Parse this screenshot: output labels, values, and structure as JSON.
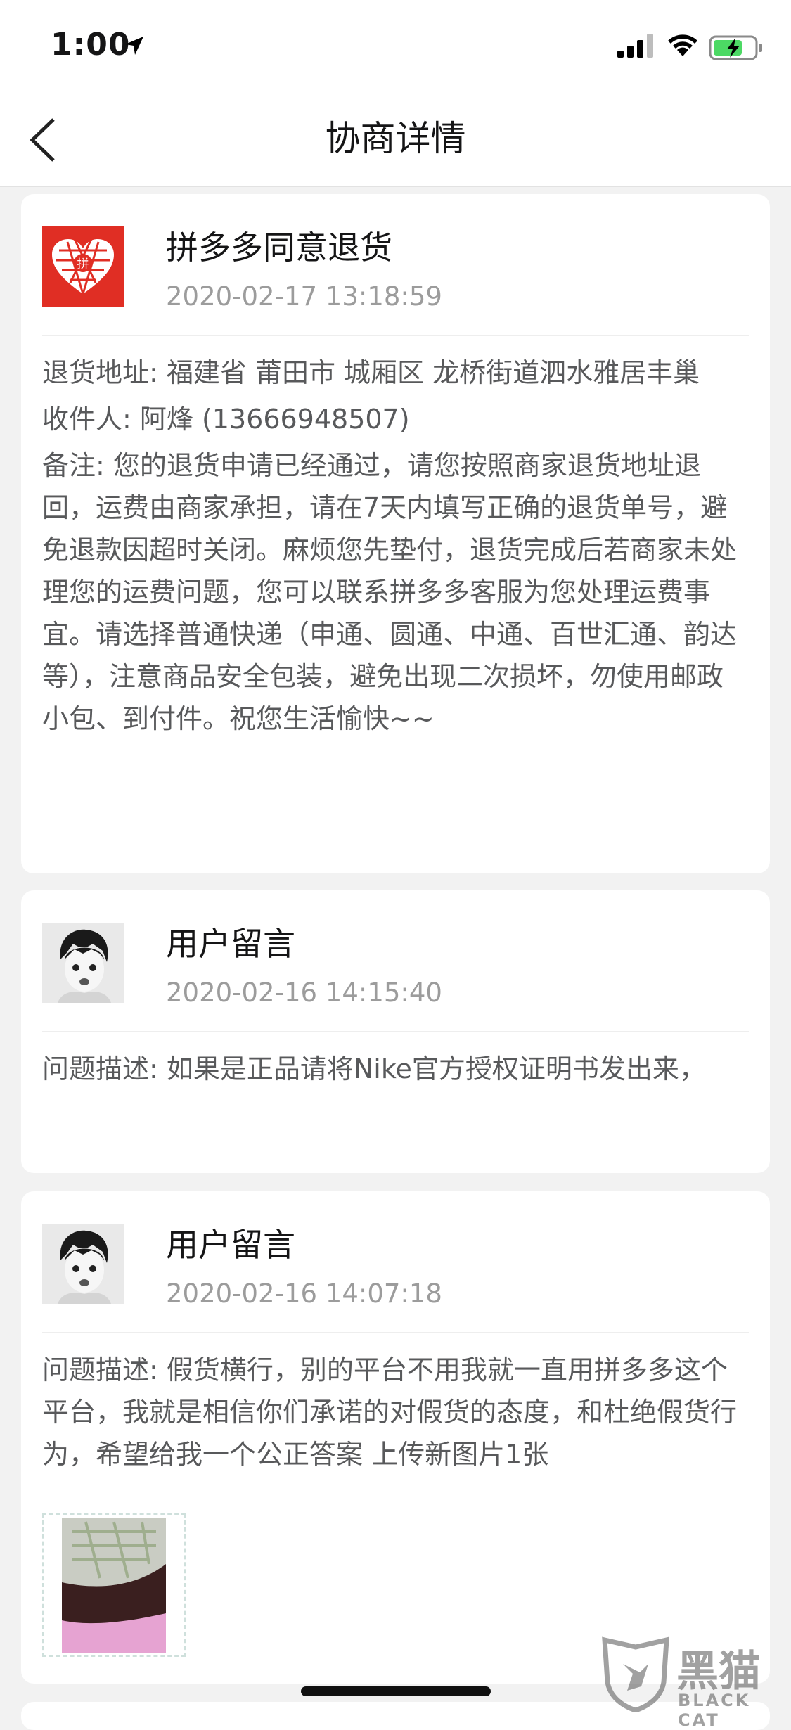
{
  "status_bar": {
    "time": "1:00"
  },
  "nav": {
    "title": "协商详情"
  },
  "cards": [
    {
      "title": "拼多多同意退货",
      "time": "2020-02-17 13:18:59",
      "lines": [
        "退货地址: 福建省 莆田市 城厢区 龙桥街道泗水雅居丰巢",
        "收件人: 阿烽 (13666948507)",
        "备注: 您的退货申请已经通过，请您按照商家退货地址退回，运费由商家承担，请在7天内填写正确的退货单号，避免退款因超时关闭。麻烦您先垫付，退货完成后若商家未处理您的运费问题，您可以联系拼多多客服为您处理运费事宜。请选择普通快递（申通、圆通、中通、百世汇通、韵达等），注意商品安全包装，避免出现二次损坏，勿使用邮政小包、到付件。祝您生活愉快~~"
      ]
    },
    {
      "title": "用户留言",
      "time": "2020-02-16 14:15:40",
      "lines": [
        "问题描述: 如果是正品请将Nike官方授权证明书发出来，"
      ]
    },
    {
      "title": "用户留言",
      "time": "2020-02-16 14:07:18",
      "lines": [
        "问题描述: 假货横行，别的平台不用我就一直用拼多多这个平台，我就是相信你们承诺的对假货的态度，和杜绝假货行为，希望给我一个公正答案 上传新图片1张"
      ]
    }
  ],
  "watermark": {
    "text": "黑猫",
    "sub": "BLACK CAT"
  },
  "colors": {
    "brand_red": "#e02e24",
    "text_secondary": "#9c9c9c",
    "background": "#f2f2f2"
  }
}
